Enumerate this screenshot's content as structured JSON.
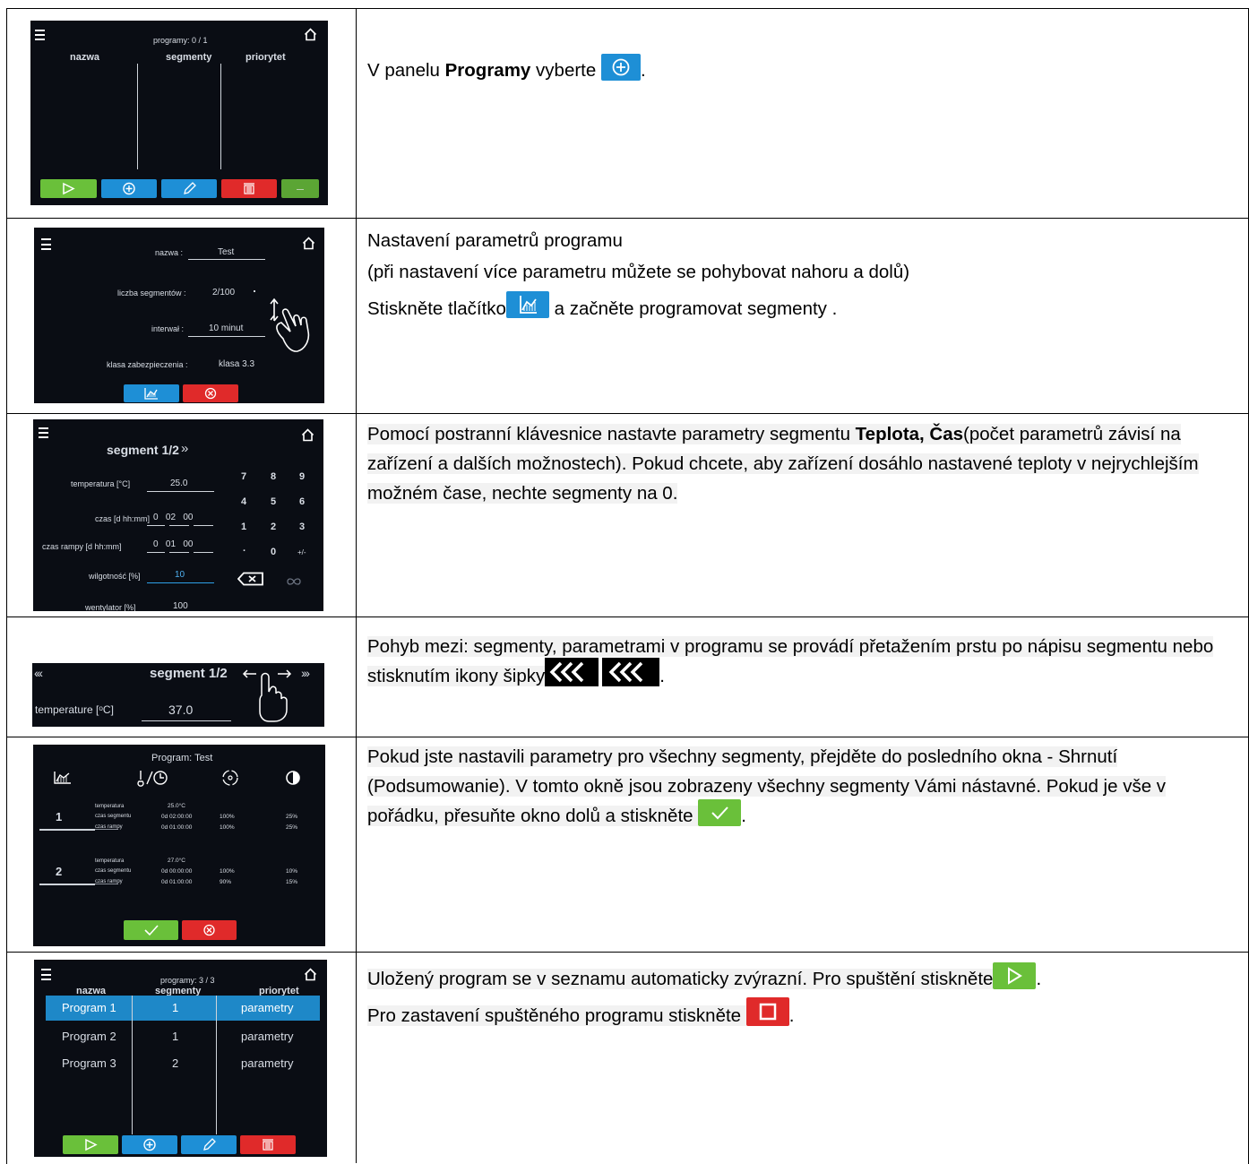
{
  "rows": [
    {
      "screen": {
        "title": "programy: 0 / 1",
        "columns": [
          "nazwa",
          "segmenty",
          "priorytet"
        ]
      },
      "text": {
        "p1_a": "V panelu ",
        "p1_b": "Programy",
        "p1_c": " vyberte ",
        "p1_d": "."
      }
    },
    {
      "screen": {
        "name_label": "nazwa :",
        "name_value": "Test",
        "segments_label": "liczba segmentów :",
        "segments_value": "2/100",
        "interval_label": "interwał :",
        "interval_value": "10 minut",
        "security_label": "klasa zabezpieczenia :",
        "security_value": "klasa 3.3"
      },
      "text": {
        "line1": "Nastavení parametrů programu",
        "line2": "(při nastavení více parametru můžete se pohybovat nahoru a dolů)",
        "line3_a": "Stiskněte tlačítko",
        "line3_b": " a začněte programovat segmenty ."
      }
    },
    {
      "screen": {
        "title": "segment 1/2",
        "title_arrow": "»",
        "params": [
          {
            "label": "temperatura [°C]",
            "value": "25.0"
          },
          {
            "label": "czas [d hh:mm]",
            "value": "0   02   00"
          },
          {
            "label": "czas rampy [d hh:mm]",
            "value": "0   01   00"
          },
          {
            "label": "wilgotność [%]",
            "value": "10"
          },
          {
            "label": "wentylator [%]",
            "value": "100"
          }
        ],
        "keys": [
          "7",
          "8",
          "9",
          "4",
          "5",
          "6",
          "1",
          "2",
          "3",
          ".",
          "0",
          "+/-"
        ]
      },
      "text": {
        "a": "Pomocí postranní klávesnice nastavte parametry segmentu ",
        "b": "Teplota, Čas",
        "c": "(počet parametrů závisí na zařízení a dalších možnostech). Pokud chcete, aby zařízení dosáhlo nastavené teploty v nejrychlejším možném čase, nechte segmenty na 0."
      }
    },
    {
      "screen": {
        "left_arrows": "‹‹‹",
        "title": "segment 1/2",
        "right_arrows": "›››",
        "param_label": "temperature [ᵒC]",
        "param_value": "37.0"
      },
      "text": {
        "a": "Pohyb mezi: segmenty, parametrami v programu  se provádí přetažením prstu po nápisu segmentu nebo stisknutím ikony šipky",
        "b": "."
      }
    },
    {
      "screen": {
        "title": "Program: Test",
        "segments": [
          {
            "num": "1",
            "rows": [
              {
                "label": "temperatura",
                "value": "25.0°C",
                "fan": "",
                "light": ""
              },
              {
                "label": "czas segmentu",
                "value": "0d 02:00:00",
                "fan": "100%",
                "light": "25%"
              },
              {
                "label": "czas rampy",
                "value": "0d 01:00:00",
                "fan": "100%",
                "light": "25%"
              }
            ]
          },
          {
            "num": "2",
            "rows": [
              {
                "label": "temperatura",
                "value": "27.0°C",
                "fan": "",
                "light": ""
              },
              {
                "label": "czas segmentu",
                "value": "0d 00:00:00",
                "fan": "100%",
                "light": "10%"
              },
              {
                "label": "czas rampy",
                "value": "0d 01:00:00",
                "fan": "90%",
                "light": "15%"
              }
            ]
          }
        ]
      },
      "text": {
        "a": "Pokud jste nastavili parametry pro všechny segmenty, přejděte do posledního okna - Shrnutí (Podsumowanie). V tomto okně jsou zobrazeny všechny segmenty Vámi nástavné. Pokud je vše v pořádku, přesuňte okno dolů a stiskněte ",
        "b": "."
      }
    },
    {
      "screen": {
        "title": "programy: 3 / 3",
        "columns": [
          "nazwa",
          "segmenty",
          "priorytet"
        ],
        "programs": [
          {
            "name": "Program 1",
            "segments": "1",
            "priority": "parametry"
          },
          {
            "name": "Program 2",
            "segments": "1",
            "priority": "parametry"
          },
          {
            "name": "Program 3",
            "segments": "2",
            "priority": "parametry"
          }
        ]
      },
      "text": {
        "a": "Uložený program se v seznamu automaticky zvýrazní. Pro spuštění stiskněte",
        "b": ".",
        "c": "Pro zastavení spuštěného programu stiskněte ",
        "d": "."
      }
    }
  ],
  "colors": {
    "green": "#6ac03a",
    "blue": "#1e8fd6",
    "red": "#e02a2a",
    "selected_row": "#1e88c8",
    "screen_bg": "#0a0d14"
  }
}
